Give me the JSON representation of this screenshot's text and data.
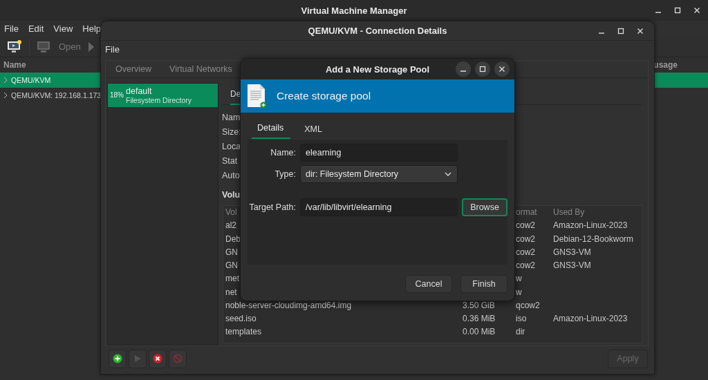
{
  "main_window": {
    "title": "Virtual Machine Manager",
    "menu": [
      "File",
      "Edit",
      "View",
      "Help"
    ],
    "toolbar": {
      "open_label": "Open",
      "open_disabled": true
    },
    "columns": [
      "Name",
      "usage"
    ],
    "connections": [
      {
        "name": "QEMU/KVM",
        "selected": true
      },
      {
        "name": "QEMU/KVM: 192.168.1.173",
        "selected": false
      }
    ]
  },
  "details_window": {
    "title": "QEMU/KVM - Connection Details",
    "menu": [
      "File"
    ],
    "tabs": [
      {
        "label": "Overview",
        "selected": false
      },
      {
        "label": "Virtual Networks",
        "selected": false
      }
    ],
    "pools": [
      {
        "usage": "18%",
        "name": "default",
        "type": "Filesystem Directory",
        "selected": true
      }
    ],
    "pool_buttons": [
      {
        "kind": "add",
        "disabled": false
      },
      {
        "kind": "start",
        "disabled": true
      },
      {
        "kind": "delete",
        "disabled": false
      },
      {
        "kind": "stop",
        "disabled": true
      }
    ],
    "pane_tab": {
      "label": "De",
      "selected": true
    },
    "fields": [
      "Nam",
      "Size:",
      "Loca",
      "Stat",
      "Auto"
    ],
    "volumes_heading": "Volu",
    "volume_columns": [
      "Vol",
      "ormat",
      "Used By"
    ],
    "volumes": [
      {
        "name": "al2",
        "format": "cow2",
        "used_by": "Amazon-Linux-2023"
      },
      {
        "name": "Deb",
        "format": "cow2",
        "used_by": "Debian-12-Bookworm"
      },
      {
        "name": "GN",
        "format": "cow2",
        "used_by": "GNS3-VM"
      },
      {
        "name": "GN",
        "format": "cow2",
        "used_by": "GNS3-VM"
      },
      {
        "name": "met",
        "format": "w"
      },
      {
        "name": "net",
        "format": "w"
      },
      {
        "name": "noble-server-cloudimg-amd64.img",
        "size": "3.50 GiB",
        "format": "qcow2"
      },
      {
        "name": "seed.iso",
        "size": "0.36 MiB",
        "format": "iso",
        "used_by": "Amazon-Linux-2023"
      },
      {
        "name": "templates",
        "size": "0.00 MiB",
        "format": "dir"
      }
    ],
    "apply": {
      "label": "Apply",
      "disabled": true
    }
  },
  "dialog": {
    "title": "Add a New Storage Pool",
    "banner": "Create storage pool",
    "tabs": [
      {
        "label": "Details",
        "selected": true
      },
      {
        "label": "XML",
        "selected": false
      }
    ],
    "fields": [
      {
        "kind": "text",
        "label": "Name:",
        "value": "elearning"
      },
      {
        "kind": "select",
        "label": "Type:",
        "value": "dir: Filesystem Directory"
      },
      {
        "kind": "path",
        "label": "Target Path:",
        "value": "/var/lib/libvirt/elearning",
        "button": "Browse"
      }
    ],
    "buttons": [
      "Cancel",
      "Finish"
    ]
  }
}
